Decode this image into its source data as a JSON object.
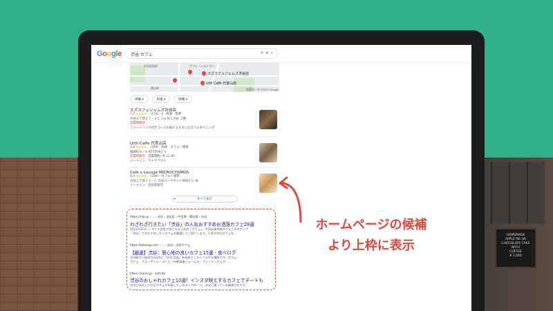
{
  "google": {
    "logo": [
      "G",
      "o",
      "o",
      "g",
      "l",
      "e"
    ],
    "search_value": "渋谷 カフェ"
  },
  "map": {
    "labels": [
      "カフェ・レストラン",
      "スズカフェジェムズ渋谷店",
      "Urth Caffe 代官山店",
      "地図データ ©2021 Google",
      "渋谷区役所",
      "恵比寿"
    ]
  },
  "filters": [
    "評価",
    "料金",
    "時間"
  ],
  "places": [
    {
      "name": "スズカフェジェムズ渋谷店",
      "rating": "3.7",
      "rating_line": "(176) · 0 · 和食 · 喫茶",
      "address": "渋谷３丁目２７−１１ ＧＥＭＳ渋谷 ３階",
      "status": "営業時間外",
      "desc": "フリードリンク付きコースも揃えるモダンなカフェダイニング"
    },
    {
      "name": "Urth Caffe 代官山店",
      "rating": "3.8",
      "rating_line": "(394) · 和食 · カフェ・喫茶",
      "address": "猿楽町８−９ NTT渋谷ビル",
      "status": "営業時間外",
      "status_suffix": " · 営業開始: 木 11:00",
      "desc": "イートイン · テイクアウト"
    },
    {
      "name": "Cafe x Lounge MICROCOSMOS",
      "rating": "4.0",
      "rating_line": "(289) · カフェ・喫茶",
      "address": "渋谷１丁目２３−６ 渋谷パークサイド共同ビル 9F",
      "desc": "イートイン · 店先受取可"
    }
  ],
  "more_button": "すべて表示",
  "results": [
    {
      "url": "https://ntp.jp › ... › 渋谷 › 渋谷区・中目黒・恵比寿 › 渋谷",
      "title": "わざわざ行きたい「渋谷」の人気おすすめお洒落カフェ28選",
      "snip1": "2021/03/10 — 今ドキ女性が気になる人気の「カフェ」。今回は東京都内でも人気のエリア",
      "snip2": "「渋谷」でおすすめしたいカフェを厳選してご紹介します。人気の渋谷カフェを..."
    },
    {
      "url": "https://tabelog.com › ... › 渋谷 › 渋谷カフェ",
      "title": "【厳選】渋谷：居心地の良いカフェ15選 - 食べログ",
      "snip1": "渋谷駅から徒歩5分以内に『渋谷 宮益』を始めとしたくつろげる場所です。カフェ",
      "snip2": "カフェ、ブルーボトル・コーヒーの創設者ジェームス・フリーマンさんが ..."
    },
    {
      "url": "https://aumo.jp › articles",
      "title": "渋谷のおしゃれカフェ10選！インスタ映えするカフェでデートも",
      "snip1": "渋谷にはおしゃれなカフェが充実しているエリアの一つ。渋谷に通っている事者がおすす"
    }
  ],
  "callout": {
    "line1": "ホームページの候補",
    "line2": "より上枠に表示"
  },
  "chalkboard": [
    "HOMEMADE",
    "APPLE PIE OR",
    "CHOCOLATE CAKE",
    "WITH",
    "COFFEE",
    "¥ 1,000"
  ],
  "colors": {
    "green_band": "#2fb08b",
    "accent_red": "#e0463a",
    "link_blue": "#1a0dab"
  }
}
